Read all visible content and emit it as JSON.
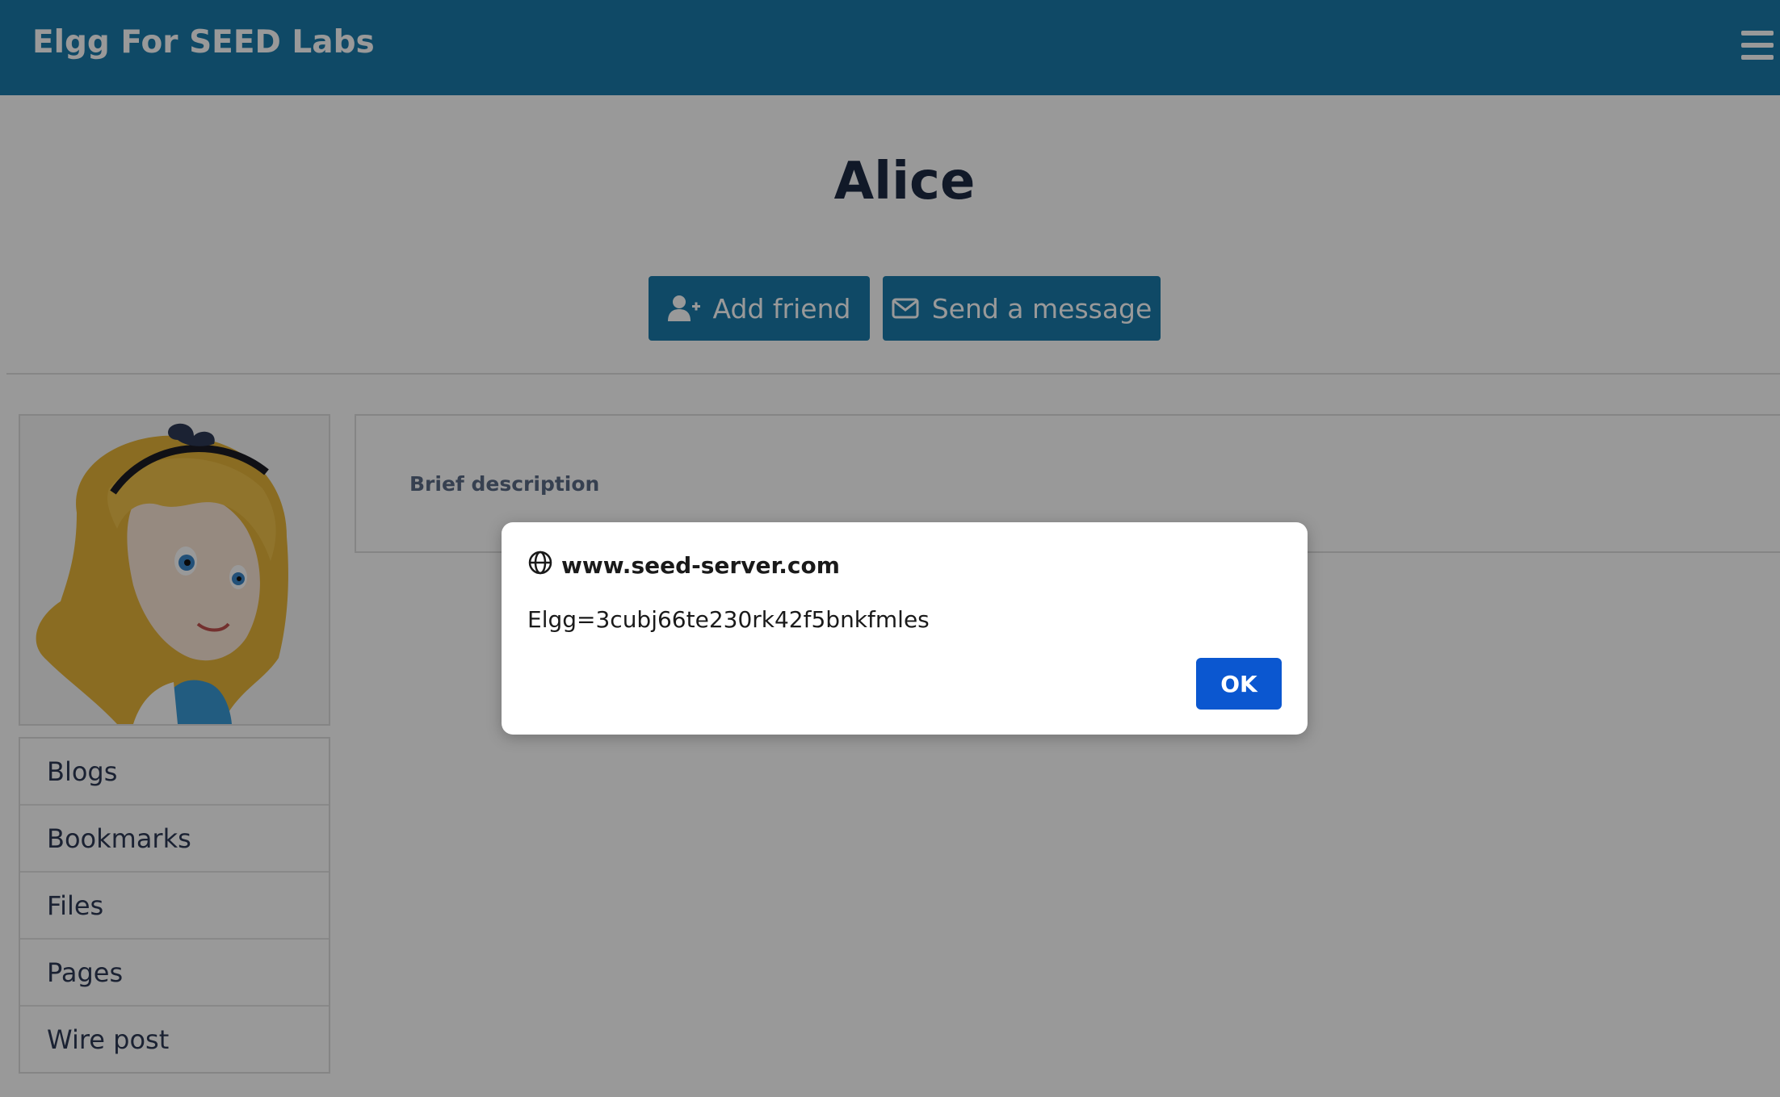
{
  "header": {
    "site_title": "Elgg For SEED Labs",
    "menu_icon": "hamburger-menu-icon",
    "background_color": "#1a7bab"
  },
  "profile": {
    "name": "Alice",
    "actions": {
      "add_friend_label": "Add friend",
      "add_friend_icon": "user-plus-icon",
      "send_message_label": "Send a message",
      "send_message_icon": "envelope-icon"
    },
    "avatar": "alice-avatar",
    "description_label": "Brief description"
  },
  "sidebar": {
    "items": [
      {
        "label": "Blogs"
      },
      {
        "label": "Bookmarks"
      },
      {
        "label": "Files"
      },
      {
        "label": "Pages"
      },
      {
        "label": "Wire post"
      }
    ]
  },
  "alert_dialog": {
    "origin": "www.seed-server.com",
    "origin_icon": "globe-icon",
    "message": "Elgg=3cubj66te230rk42f5bnkfmles",
    "ok_label": "OK",
    "ok_color": "#0b57d0"
  }
}
